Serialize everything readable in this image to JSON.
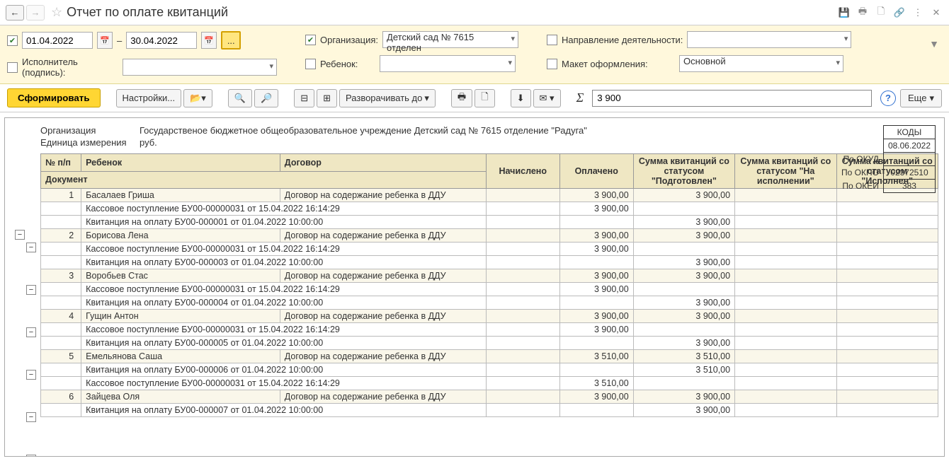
{
  "header": {
    "title": "Отчет по оплате квитанций"
  },
  "filters": {
    "date_from": "01.04.2022",
    "date_to": "30.04.2022",
    "dash": "–",
    "dots": "...",
    "org_label": "Организация:",
    "org_value": "Детский сад № 7615 отделен",
    "activity_label": "Направление деятельности:",
    "executor_label": "Исполнитель (подпись):",
    "child_label": "Ребенок:",
    "layout_label": "Макет оформления:",
    "layout_value": "Основной"
  },
  "toolbar": {
    "form": "Сформировать",
    "settings": "Настройки...",
    "expand": "Разворачивать до",
    "sum_value": "3 900",
    "more": "Еще"
  },
  "codes": {
    "title": "КОДЫ",
    "date": "08.06.2022",
    "okud_lbl": "По ОКУД",
    "okpo_lbl": "По ОКПО",
    "okpo": "02372510",
    "okei_lbl": "По ОКЕИ",
    "okei": "383"
  },
  "meta": {
    "org_lbl": "Организация",
    "org_val": "Государственое бюджетное общеобразовательное учреждение Детский сад № 7615 отделение \"Радуга\"",
    "unit_lbl": "Единица измерения",
    "unit_val": "руб."
  },
  "columns": {
    "np": "№ п/п",
    "child": "Ребенок",
    "contract": "Договор",
    "accrued": "Начислено",
    "paid": "Оплачено",
    "sum_prep": "Сумма квитанций со статусом \"Подготовлен\"",
    "sum_exec": "Сумма квитанций со статусом \"На исполнении\"",
    "sum_done": "Сумма квитанций со статусом \"Исполнен\"",
    "doc": "Документ"
  },
  "rows": [
    {
      "idx": "1",
      "child": "Басалаев Гриша",
      "contract": "Договор на содержание ребенка в ДДУ",
      "paid": "3 900,00",
      "prep": "3 900,00",
      "docs": [
        {
          "text": "Кассовое поступление БУ00-00000031 от 15.04.2022 16:14:29",
          "paid": "3 900,00"
        },
        {
          "text": "Квитанция на оплату БУ00-000001 от 01.04.2022 10:00:00",
          "prep": "3 900,00"
        }
      ]
    },
    {
      "idx": "2",
      "child": "Борисова Лена",
      "contract": "Договор на содержание ребенка в ДДУ",
      "paid": "3 900,00",
      "prep": "3 900,00",
      "docs": [
        {
          "text": "Кассовое поступление БУ00-00000031 от 15.04.2022 16:14:29",
          "paid": "3 900,00"
        },
        {
          "text": "Квитанция на оплату БУ00-000003 от 01.04.2022 10:00:00",
          "prep": "3 900,00"
        }
      ]
    },
    {
      "idx": "3",
      "child": "Воробьев Стас",
      "contract": "Договор на содержание ребенка в ДДУ",
      "paid": "3 900,00",
      "prep": "3 900,00",
      "docs": [
        {
          "text": "Кассовое поступление БУ00-00000031 от 15.04.2022 16:14:29",
          "paid": "3 900,00"
        },
        {
          "text": "Квитанция на оплату БУ00-000004 от 01.04.2022 10:00:00",
          "prep": "3 900,00"
        }
      ]
    },
    {
      "idx": "4",
      "child": "Гущин Антон",
      "contract": "Договор на содержание ребенка в ДДУ",
      "paid": "3 900,00",
      "prep": "3 900,00",
      "docs": [
        {
          "text": "Кассовое поступление БУ00-00000031 от 15.04.2022 16:14:29",
          "paid": "3 900,00"
        },
        {
          "text": "Квитанция на оплату БУ00-000005 от 01.04.2022 10:00:00",
          "prep": "3 900,00"
        }
      ]
    },
    {
      "idx": "5",
      "child": "Емельянова Саша",
      "contract": "Договор на содержание ребенка в ДДУ",
      "paid": "3 510,00",
      "prep": "3 510,00",
      "docs": [
        {
          "text": "Квитанция на оплату БУ00-000006 от 01.04.2022 10:00:00",
          "prep": "3 510,00"
        },
        {
          "text": "Кассовое поступление БУ00-00000031 от 15.04.2022 16:14:29",
          "paid": "3 510,00"
        }
      ]
    },
    {
      "idx": "6",
      "child": "Зайцева Оля",
      "contract": "Договор на содержание ребенка в ДДУ",
      "paid": "3 900,00",
      "prep": "3 900,00",
      "docs": [
        {
          "text": "Квитанция на оплату БУ00-000007 от 01.04.2022 10:00:00",
          "prep": "3 900,00"
        }
      ]
    }
  ]
}
